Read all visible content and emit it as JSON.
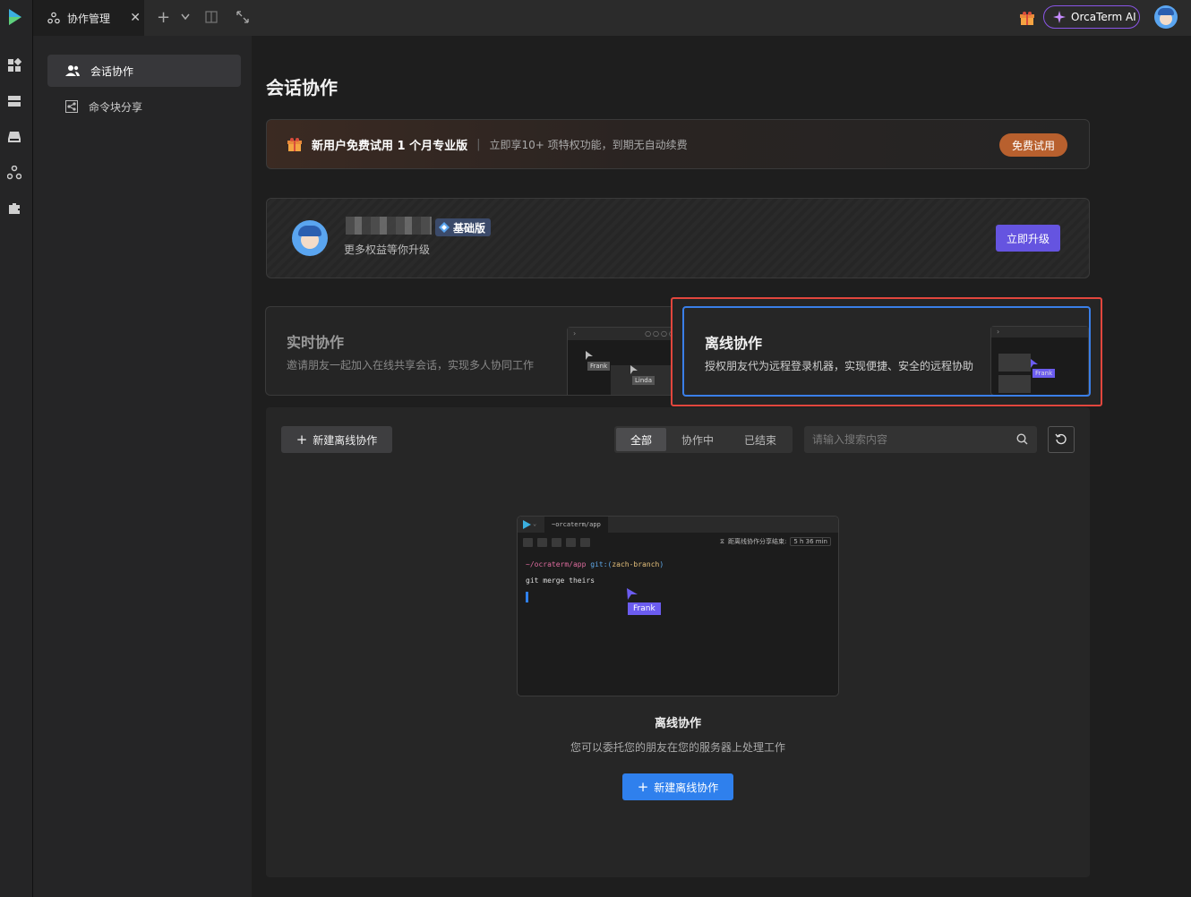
{
  "topbar": {
    "tab_label": "协作管理",
    "tab_close": "✕",
    "add": "+",
    "ai_label": "OrcaTerm AI"
  },
  "icons": {
    "rail": [
      "dashboard-icon",
      "server-icon",
      "storage-icon",
      "collaboration-icon",
      "plugin-icon"
    ]
  },
  "sidebar": {
    "items": [
      {
        "label": "会话协作",
        "icon": "users-icon",
        "active": true
      },
      {
        "label": "命令块分享",
        "icon": "share-icon",
        "active": false
      }
    ]
  },
  "main": {
    "title": "会话协作",
    "promo": {
      "headline": "新用户免费试用 1 个月专业版",
      "separator": "|",
      "sub": "立即享10+ 项特权功能，到期无自动续费",
      "button": "免费试用"
    },
    "profile": {
      "plan": "基础版",
      "sub": "更多权益等你升级",
      "button": "立即升级"
    },
    "modes": {
      "realtime": {
        "title": "实时协作",
        "desc": "邀请朋友一起加入在线共享会话，实现多人协同工作",
        "tag1": "Frank",
        "tag2": "Linda"
      },
      "offline": {
        "title": "离线协作",
        "desc": "授权朋友代为远程登录机器，实现便捷、安全的远程协助",
        "tag": "Frank"
      }
    },
    "list": {
      "new_button": "新建离线协作",
      "filters": [
        "全部",
        "协作中",
        "已结束"
      ],
      "search_placeholder": "请输入搜索内容"
    },
    "preview": {
      "tab": "~orcaterm/app",
      "timer_label": "距离线协作分享结束:",
      "timer_value": "5 h 36 min",
      "line1_path": "~/ocraterm/app",
      "line1_git": " git:(",
      "line1_branch": "zach-branch",
      "line1_end": ")",
      "line2": "git merge theirs",
      "cursor_tag": "Frank"
    },
    "empty": {
      "title": "离线协作",
      "sub": "您可以委托您的朋友在您的服务器上处理工作",
      "button": "新建离线协作"
    }
  },
  "colors": {
    "accent": "#2f80ed",
    "upgrade": "#6554e0",
    "promo_button": "#b8602e",
    "highlight_outline": "#e2463d",
    "selected_card": "#3a7fe8"
  }
}
